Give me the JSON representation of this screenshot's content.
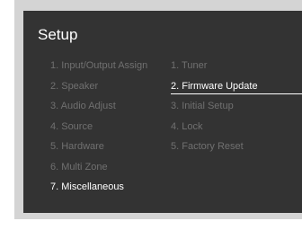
{
  "title": "Setup",
  "menu_left": [
    {
      "label": "1. Input/Output Assign",
      "state": "dim"
    },
    {
      "label": "2. Speaker",
      "state": "dim"
    },
    {
      "label": "3. Audio Adjust",
      "state": "dim"
    },
    {
      "label": "4. Source",
      "state": "dim"
    },
    {
      "label": "5. Hardware",
      "state": "dim"
    },
    {
      "label": "6. Multi Zone",
      "state": "dim"
    },
    {
      "label": "7. Miscellaneous",
      "state": "active"
    }
  ],
  "menu_right": [
    {
      "label": "1. Tuner",
      "state": "dim"
    },
    {
      "label": "2. Firmware Update",
      "state": "selected"
    },
    {
      "label": "3. Initial Setup",
      "state": "dim"
    },
    {
      "label": "4. Lock",
      "state": "dim"
    },
    {
      "label": "5. Factory Reset",
      "state": "dim"
    }
  ],
  "colors": {
    "screen_bg": "#333333",
    "bezel": "#d4d4d4",
    "text_active": "#ffffff",
    "text_dim": "#707070"
  }
}
